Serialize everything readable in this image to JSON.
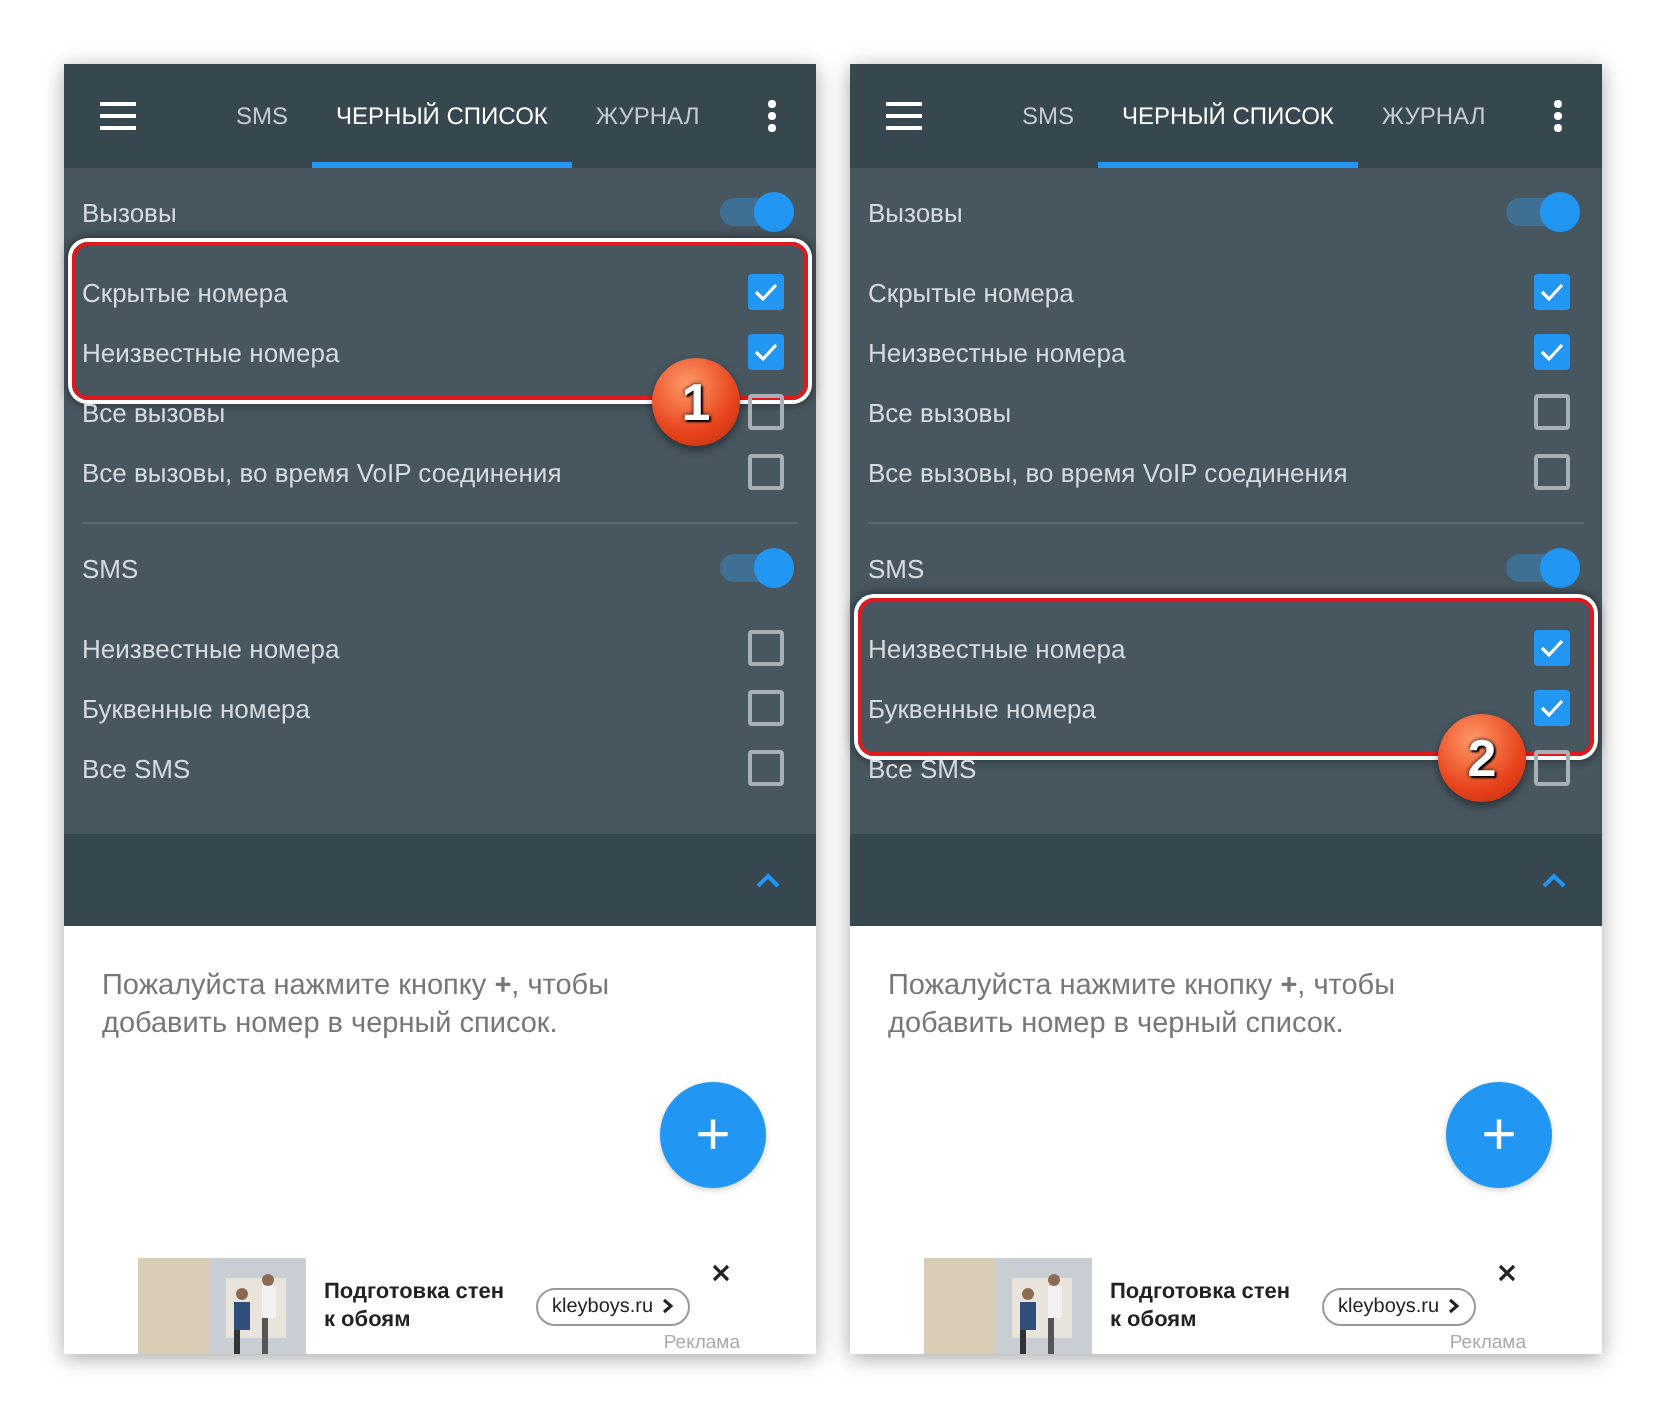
{
  "panels": [
    {
      "tabs": [
        {
          "label": "SMS",
          "selected": false
        },
        {
          "label": "ЧЕРНЫЙ СПИСОК",
          "selected": true
        },
        {
          "label": "ЖУРНАЛ",
          "selected": false
        }
      ],
      "sections": [
        {
          "title": "Вызовы",
          "on": true,
          "callout": "1",
          "rows": [
            {
              "label": "Скрытые номера",
              "checked": true,
              "highlighted": true
            },
            {
              "label": "Неизвестные номера",
              "checked": true,
              "highlighted": true
            },
            {
              "label": "Все вызовы",
              "checked": false,
              "highlighted": false
            },
            {
              "label": "Все вызовы, во время VoIP соединения",
              "checked": false,
              "highlighted": false
            }
          ]
        },
        {
          "title": "SMS",
          "on": true,
          "rows": [
            {
              "label": "Неизвестные номера",
              "checked": false,
              "highlighted": false
            },
            {
              "label": "Буквенные номера",
              "checked": false,
              "highlighted": false
            },
            {
              "label": "Все SMS",
              "checked": false,
              "highlighted": false
            }
          ]
        }
      ],
      "message": "Пожалуйста нажмите кнопку **+**, чтобы добавить номер в черный список.",
      "fab": "+",
      "ad": {
        "title": "Подготовка стен к обоям",
        "link": "kleyboys.ru",
        "label": "Реклама"
      }
    },
    {
      "tabs": [
        {
          "label": "SMS",
          "selected": false
        },
        {
          "label": "ЧЕРНЫЙ СПИСОК",
          "selected": true
        },
        {
          "label": "ЖУРНАЛ",
          "selected": false
        }
      ],
      "sections": [
        {
          "title": "Вызовы",
          "on": true,
          "rows": [
            {
              "label": "Скрытые номера",
              "checked": true,
              "highlighted": false
            },
            {
              "label": "Неизвестные номера",
              "checked": true,
              "highlighted": false
            },
            {
              "label": "Все вызовы",
              "checked": false,
              "highlighted": false
            },
            {
              "label": "Все вызовы, во время VoIP соединения",
              "checked": false,
              "highlighted": false
            }
          ]
        },
        {
          "title": "SMS",
          "on": true,
          "callout": "2",
          "rows": [
            {
              "label": "Неизвестные номера",
              "checked": true,
              "highlighted": true
            },
            {
              "label": "Буквенные номера",
              "checked": true,
              "highlighted": true
            },
            {
              "label": "Все SMS",
              "checked": false,
              "highlighted": false
            }
          ]
        }
      ],
      "message": "Пожалуйста нажмите кнопку **+**, чтобы добавить номер в черный список.",
      "fab": "+",
      "ad": {
        "title": "Подготовка стен к обоям",
        "link": "kleyboys.ru",
        "label": "Реклама"
      }
    }
  ]
}
